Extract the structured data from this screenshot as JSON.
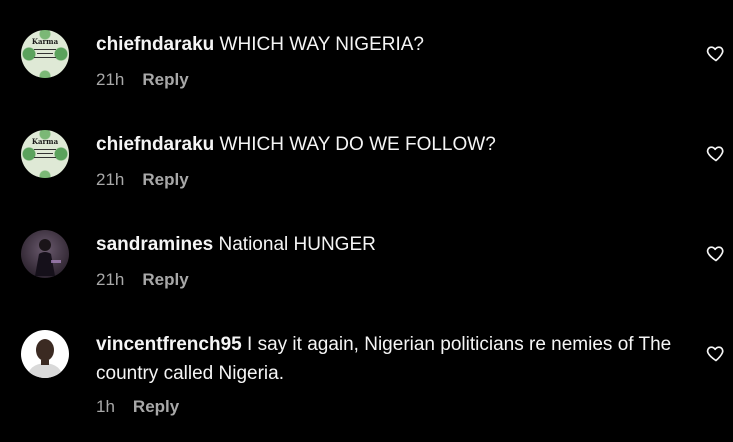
{
  "comments": [
    {
      "username": "chiefndaraku",
      "text": "WHICH WAY NIGERIA?",
      "time": "21h",
      "reply_label": "Reply",
      "avatar_caption": "Karma"
    },
    {
      "username": "chiefndaraku",
      "text": "WHICH WAY DO WE FOLLOW?",
      "time": "21h",
      "reply_label": "Reply",
      "avatar_caption": "Karma"
    },
    {
      "username": "sandramines",
      "text": "National HUNGER",
      "time": "21h",
      "reply_label": "Reply"
    },
    {
      "username": "vincentfrench95",
      "text": "I say it again, Nigerian politicians re nemies of The country called Nigeria.",
      "time": "1h",
      "reply_label": "Reply"
    }
  ],
  "colors": {
    "background": "#000000",
    "primary_text": "#f5f5f5",
    "secondary_text": "#a8a8a8"
  },
  "icons": {
    "like": "heart-outline-icon"
  }
}
